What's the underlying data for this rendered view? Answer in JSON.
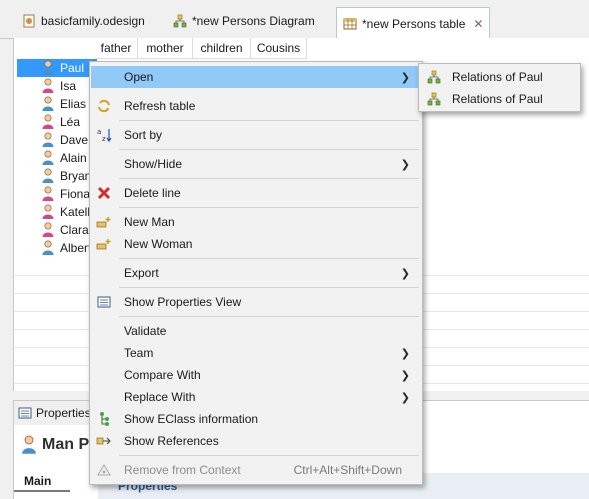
{
  "tabs": [
    {
      "label": "basicfamily.odesign",
      "icon": "odesign-file-icon"
    },
    {
      "label": "*new Persons Diagram",
      "icon": "diagram-icon"
    },
    {
      "label": "*new Persons table",
      "icon": "table-icon"
    }
  ],
  "table": {
    "columns": [
      "father",
      "mother",
      "children",
      "Cousins"
    ],
    "rows": [
      {
        "name": "Paul",
        "gender": "male"
      },
      {
        "name": "Isa",
        "gender": "female"
      },
      {
        "name": "Elias",
        "gender": "male"
      },
      {
        "name": "Léa",
        "gender": "female"
      },
      {
        "name": "Dave",
        "gender": "male"
      },
      {
        "name": "Alain",
        "gender": "male"
      },
      {
        "name": "Bryan",
        "gender": "male"
      },
      {
        "name": "Fiona",
        "gender": "female"
      },
      {
        "name": "Katell",
        "gender": "female"
      },
      {
        "name": "Clara",
        "gender": "female"
      },
      {
        "name": "Albert",
        "gender": "male"
      }
    ]
  },
  "context_menu": {
    "open": "Open",
    "refresh_table": "Refresh table",
    "sort_by": "Sort by",
    "show_hide": "Show/Hide",
    "delete_line": "Delete line",
    "new_man": "New Man",
    "new_woman": "New Woman",
    "export": "Export",
    "show_properties_view": "Show Properties View",
    "validate": "Validate",
    "team": "Team",
    "compare_with": "Compare With",
    "replace_with": "Replace With",
    "show_eclass_information": "Show EClass information",
    "show_references": "Show References",
    "remove_from_context": "Remove from Context",
    "remove_from_context_shortcut": "Ctrl+Alt+Shift+Down"
  },
  "open_submenu": [
    "Relations of Paul",
    "Relations of Paul"
  ],
  "properties": {
    "tab_label": "Properties",
    "title": "Man P",
    "main_tab": "Main",
    "section_label": "Properties"
  },
  "colors": {
    "selection": "#3399ff",
    "menu_highlight": "#91c9f7",
    "male": "#4a90c8",
    "female": "#d04a8a"
  }
}
